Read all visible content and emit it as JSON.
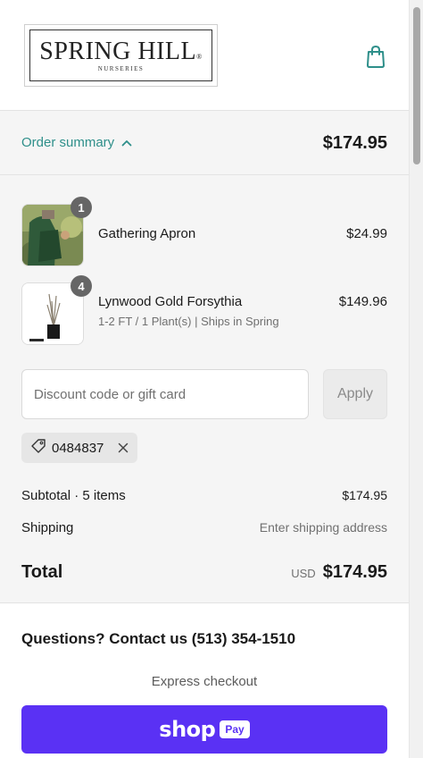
{
  "header": {
    "logo_title": "SPRING HILL",
    "logo_reg": "®",
    "logo_sub": "NURSERIES",
    "cart_icon": "shopping-bag-icon"
  },
  "summary": {
    "toggle_label": "Order summary",
    "toggle_icon": "chevron-up-icon",
    "total": "$174.95",
    "accent_color": "#2e8f8a"
  },
  "items": [
    {
      "name": "Gathering Apron",
      "variant": "",
      "quantity": "1",
      "price": "$24.99"
    },
    {
      "name": "Lynwood Gold Forsythia",
      "variant": "1-2 FT / 1 Plant(s) | Ships in Spring",
      "quantity": "4",
      "price": "$149.96"
    }
  ],
  "discount": {
    "placeholder": "Discount code or gift card",
    "apply_label": "Apply",
    "applied_code": "0484837",
    "tag_icon": "tag-icon",
    "remove_icon": "close-icon"
  },
  "totals": {
    "subtotal_label": "Subtotal · 5 items",
    "subtotal_value": "$174.95",
    "shipping_label": "Shipping",
    "shipping_value": "Enter shipping address",
    "total_label": "Total",
    "currency": "USD",
    "total_value": "$174.95"
  },
  "footer": {
    "contact": "Questions? Contact us (513) 354-1510",
    "express_label": "Express checkout",
    "shop_label": "shop",
    "pay_label": "Pay",
    "shoppay_color": "#5a31f4"
  }
}
